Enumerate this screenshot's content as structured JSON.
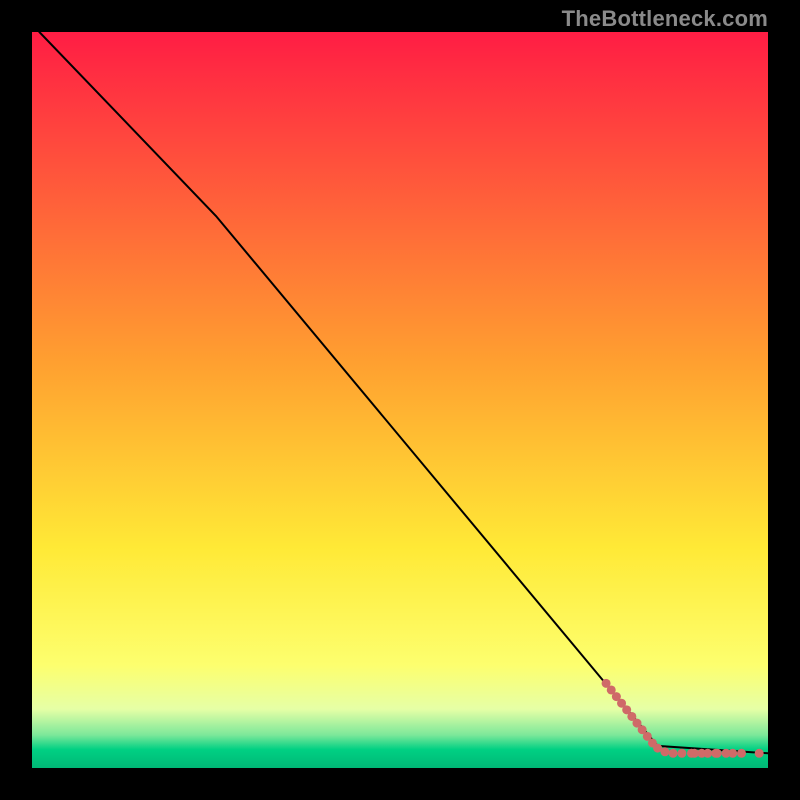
{
  "watermark": "TheBottleneck.com",
  "chart_data": {
    "type": "line",
    "title": "",
    "xlabel": "",
    "ylabel": "",
    "xlim": [
      0,
      100
    ],
    "ylim": [
      0,
      100
    ],
    "grid": false,
    "legend": false,
    "gradient_stops": [
      {
        "offset": 0.0,
        "color": "#ff1d44"
      },
      {
        "offset": 0.45,
        "color": "#ffa030"
      },
      {
        "offset": 0.7,
        "color": "#ffe936"
      },
      {
        "offset": 0.86,
        "color": "#fdff6e"
      },
      {
        "offset": 0.92,
        "color": "#e6ffa6"
      },
      {
        "offset": 0.955,
        "color": "#7de89a"
      },
      {
        "offset": 0.975,
        "color": "#00d083"
      },
      {
        "offset": 1.0,
        "color": "#00b876"
      }
    ],
    "series": [
      {
        "name": "curve",
        "type": "line",
        "color": "#000000",
        "points": [
          {
            "x": 1.0,
            "y": 100.0
          },
          {
            "x": 25.0,
            "y": 75.0
          },
          {
            "x": 85.0,
            "y": 3.0
          },
          {
            "x": 100.0,
            "y": 2.0
          }
        ]
      },
      {
        "name": "bottom-dots",
        "type": "scatter",
        "color": "#cf6a68",
        "radius": 4.5,
        "points": [
          {
            "x": 78.0,
            "y": 11.5
          },
          {
            "x": 78.7,
            "y": 10.6
          },
          {
            "x": 79.4,
            "y": 9.7
          },
          {
            "x": 80.1,
            "y": 8.8
          },
          {
            "x": 80.8,
            "y": 7.9
          },
          {
            "x": 81.5,
            "y": 7.0
          },
          {
            "x": 82.2,
            "y": 6.1
          },
          {
            "x": 82.9,
            "y": 5.2
          },
          {
            "x": 83.6,
            "y": 4.3
          },
          {
            "x": 84.3,
            "y": 3.4
          },
          {
            "x": 85.0,
            "y": 2.7
          },
          {
            "x": 86.0,
            "y": 2.2
          },
          {
            "x": 87.1,
            "y": 2.0
          },
          {
            "x": 88.3,
            "y": 2.0
          },
          {
            "x": 89.6,
            "y": 2.0
          },
          {
            "x": 90.0,
            "y": 2.0
          },
          {
            "x": 91.0,
            "y": 2.0
          },
          {
            "x": 91.8,
            "y": 2.0
          },
          {
            "x": 92.9,
            "y": 2.0
          },
          {
            "x": 93.1,
            "y": 2.0
          },
          {
            "x": 94.3,
            "y": 2.0
          },
          {
            "x": 95.2,
            "y": 2.0
          },
          {
            "x": 96.4,
            "y": 2.0
          },
          {
            "x": 98.8,
            "y": 2.0
          }
        ]
      }
    ]
  }
}
